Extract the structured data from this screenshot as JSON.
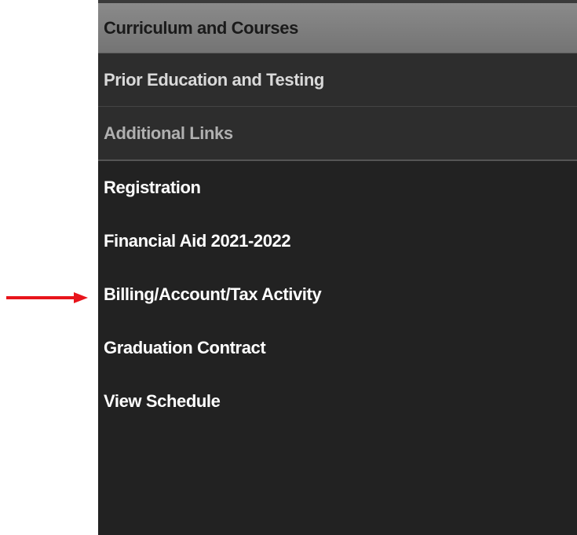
{
  "sections": [
    {
      "label": "Curriculum and Courses"
    },
    {
      "label": "Prior Education and Testing"
    },
    {
      "label": "Additional Links"
    }
  ],
  "links": [
    {
      "label": "Registration"
    },
    {
      "label": "Financial Aid 2021-2022"
    },
    {
      "label": "Billing/Account/Tax Activity"
    },
    {
      "label": "Graduation Contract"
    },
    {
      "label": "View Schedule"
    }
  ],
  "colors": {
    "annotation_arrow": "#e8141b",
    "panel_background": "#222222",
    "active_section": "#7e7e7e"
  },
  "icons": {
    "pointer": "right-arrow-icon"
  }
}
